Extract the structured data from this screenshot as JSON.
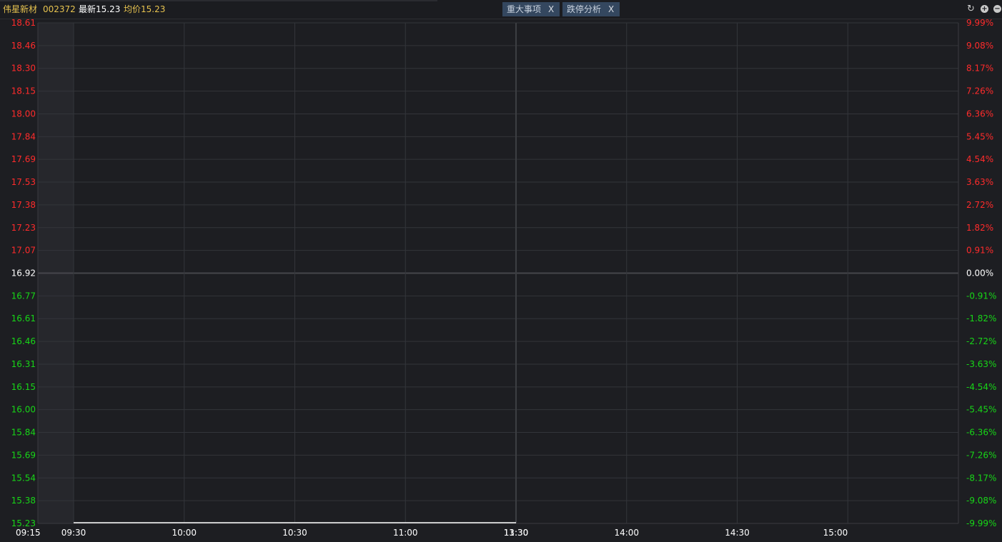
{
  "header": {
    "stock_name": "伟星新材",
    "stock_code": "002372",
    "latest": "最新15.23",
    "average": "均价15.23",
    "tabs": [
      {
        "label": "重大事项",
        "close": "X"
      },
      {
        "label": "跌停分析",
        "close": "X"
      }
    ],
    "controls": [
      "refresh-icon",
      "zoom-in-icon",
      "zoom-out-icon"
    ]
  },
  "colors": {
    "background": "#1d1e22",
    "up": "#ff2b2b",
    "down": "#17d617",
    "neutral": "#ffffff",
    "stock_name": "#e7c34f",
    "stock_code": "#e7c34f",
    "average": "#e7c34f",
    "grid": "#33353a",
    "tag_bg": "#34475f"
  },
  "chart_data": {
    "type": "line",
    "title": "",
    "previous_close": 16.92,
    "ylim": [
      15.23,
      18.61
    ],
    "y_ticks": [
      "18.61",
      "18.46",
      "18.30",
      "18.15",
      "18.00",
      "17.84",
      "17.69",
      "17.53",
      "17.38",
      "17.23",
      "17.07",
      "16.92",
      "16.77",
      "16.61",
      "16.46",
      "16.31",
      "16.15",
      "16.00",
      "15.84",
      "15.69",
      "15.54",
      "15.38",
      "15.23"
    ],
    "pct_ticks": [
      "9.99%",
      "9.08%",
      "8.17%",
      "7.26%",
      "6.36%",
      "5.45%",
      "4.54%",
      "3.63%",
      "2.72%",
      "1.82%",
      "0.91%",
      "0.00%",
      "-0.91%",
      "-1.82%",
      "-2.72%",
      "-3.63%",
      "-4.54%",
      "-5.45%",
      "-6.36%",
      "-7.26%",
      "-8.17%",
      "-9.08%",
      "-9.99%"
    ],
    "x_ticks": [
      "09:15",
      "09:30",
      "10:00",
      "10:30",
      "11:00",
      "11:30",
      "13:30",
      "14:00",
      "14:30",
      "15:00"
    ],
    "series": [
      {
        "name": "最新",
        "color": "#ffffff",
        "x": [
          "09:30",
          "11:30"
        ],
        "values": [
          15.23,
          15.23
        ]
      }
    ]
  }
}
